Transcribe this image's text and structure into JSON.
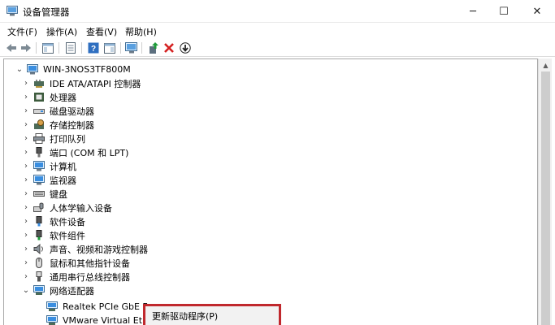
{
  "window": {
    "title": "设备管理器",
    "icon": "device-manager-icon"
  },
  "window_controls": {
    "minimize": "─",
    "maximize": "☐",
    "close": "✕"
  },
  "menu": [
    "文件(F)",
    "操作(A)",
    "查看(V)",
    "帮助(H)"
  ],
  "toolbar": {
    "icons": [
      "back-icon",
      "forward-icon",
      "console-tree-icon",
      "properties-icon",
      "help-icon",
      "show-pane-icon",
      "scan-hardware-icon",
      "update-driver-icon",
      "uninstall-icon",
      "download-icon"
    ]
  },
  "tree": {
    "root": "WIN-3NOS3TF800M",
    "categories": [
      {
        "label": "IDE ATA/ATAPI 控制器",
        "icon": "ide-controller-icon"
      },
      {
        "label": "处理器",
        "icon": "processor-icon"
      },
      {
        "label": "磁盘驱动器",
        "icon": "disk-drive-icon"
      },
      {
        "label": "存储控制器",
        "icon": "storage-controller-icon"
      },
      {
        "label": "打印队列",
        "icon": "printer-icon"
      },
      {
        "label": "端口 (COM 和 LPT)",
        "icon": "port-icon"
      },
      {
        "label": "计算机",
        "icon": "computer-icon"
      },
      {
        "label": "监视器",
        "icon": "monitor-icon"
      },
      {
        "label": "键盘",
        "icon": "keyboard-icon"
      },
      {
        "label": "人体学输入设备",
        "icon": "hid-icon"
      },
      {
        "label": "软件设备",
        "icon": "software-device-icon"
      },
      {
        "label": "软件组件",
        "icon": "software-component-icon"
      },
      {
        "label": "声音、视频和游戏控制器",
        "icon": "sound-icon"
      },
      {
        "label": "鼠标和其他指针设备",
        "icon": "mouse-icon"
      },
      {
        "label": "通用串行总线控制器",
        "icon": "usb-icon"
      },
      {
        "label": "网络适配器",
        "icon": "network-adapter-icon"
      }
    ],
    "network_children": [
      "Realtek PCIe GbE F",
      "VMware Virtual Eth"
    ]
  },
  "context_menu": {
    "items": [
      "更新驱动程序(P)"
    ]
  },
  "colors": {
    "highlight_border": "#c0282d",
    "monitor_blue": "#3a8ee0"
  }
}
